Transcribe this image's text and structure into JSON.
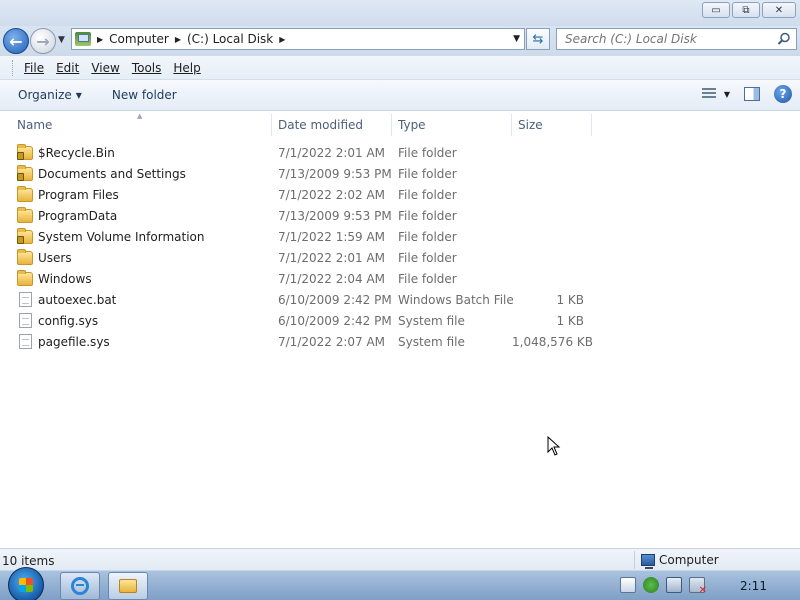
{
  "window": {
    "minimize_glyph": "▭",
    "maximize_glyph": "⧉",
    "close_glyph": "✕"
  },
  "address": {
    "crumbs": [
      "Computer",
      "(C:) Local Disk"
    ],
    "search_placeholder": "Search (C:) Local Disk"
  },
  "menu": {
    "items": [
      "File",
      "Edit",
      "View",
      "Tools",
      "Help"
    ]
  },
  "toolbar": {
    "organize": "Organize",
    "new_folder": "New folder"
  },
  "columns": {
    "name": "Name",
    "date": "Date modified",
    "type": "Type",
    "size": "Size"
  },
  "files": [
    {
      "name": "$Recycle.Bin",
      "date": "7/1/2022 2:01 AM",
      "type": "File folder",
      "size": "",
      "icon": "folder-locked-icon"
    },
    {
      "name": "Documents and Settings",
      "date": "7/13/2009 9:53 PM",
      "type": "File folder",
      "size": "",
      "icon": "folder-locked-icon"
    },
    {
      "name": "Program Files",
      "date": "7/1/2022 2:02 AM",
      "type": "File folder",
      "size": "",
      "icon": "folder-icon"
    },
    {
      "name": "ProgramData",
      "date": "7/13/2009 9:53 PM",
      "type": "File folder",
      "size": "",
      "icon": "folder-icon"
    },
    {
      "name": "System Volume Information",
      "date": "7/1/2022 1:59 AM",
      "type": "File folder",
      "size": "",
      "icon": "folder-locked-icon"
    },
    {
      "name": "Users",
      "date": "7/1/2022 2:01 AM",
      "type": "File folder",
      "size": "",
      "icon": "folder-icon"
    },
    {
      "name": "Windows",
      "date": "7/1/2022 2:04 AM",
      "type": "File folder",
      "size": "",
      "icon": "folder-icon"
    },
    {
      "name": "autoexec.bat",
      "date": "6/10/2009 2:42 PM",
      "type": "Windows Batch File",
      "size": "1 KB",
      "icon": "batch-file-icon"
    },
    {
      "name": "config.sys",
      "date": "6/10/2009 2:42 PM",
      "type": "System file",
      "size": "1 KB",
      "icon": "system-file-icon"
    },
    {
      "name": "pagefile.sys",
      "date": "7/1/2022 2:07 AM",
      "type": "System file",
      "size": "1,048,576 KB",
      "icon": "system-file-icon"
    }
  ],
  "status": {
    "count": "10 items",
    "location": "Computer"
  },
  "taskbar": {
    "clock": "2:11"
  },
  "colors": {
    "accent": "#1f5fb8",
    "folder": "#e8b43a"
  }
}
